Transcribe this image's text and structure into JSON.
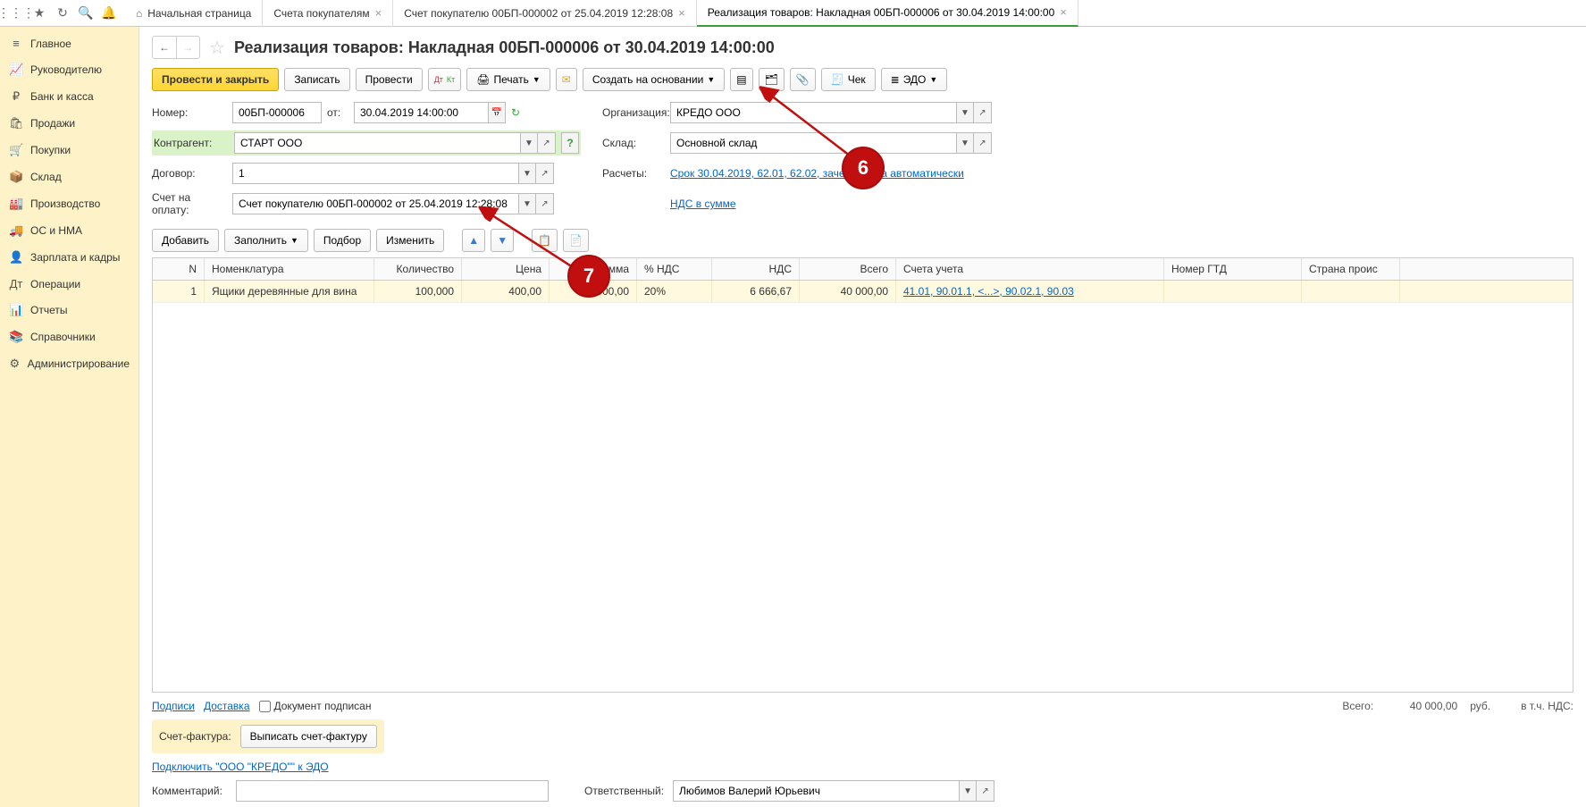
{
  "topbar_icons": [
    "grid",
    "star",
    "history",
    "search",
    "bell"
  ],
  "tabs": [
    {
      "label": "Начальная страница",
      "home": true,
      "closable": false
    },
    {
      "label": "Счета покупателям",
      "closable": true
    },
    {
      "label": "Счет покупателю 00БП-000002 от 25.04.2019 12:28:08",
      "closable": true
    },
    {
      "label": "Реализация товаров: Накладная 00БП-000006 от 30.04.2019 14:00:00",
      "closable": true,
      "active": true
    }
  ],
  "sidebar": [
    {
      "icon": "≡",
      "label": "Главное"
    },
    {
      "icon": "📈",
      "label": "Руководителю"
    },
    {
      "icon": "₽",
      "label": "Банк и касса"
    },
    {
      "icon": "🛍",
      "label": "Продажи"
    },
    {
      "icon": "🛒",
      "label": "Покупки"
    },
    {
      "icon": "📦",
      "label": "Склад"
    },
    {
      "icon": "🏭",
      "label": "Производство"
    },
    {
      "icon": "🚚",
      "label": "ОС и НМА"
    },
    {
      "icon": "👤",
      "label": "Зарплата и кадры"
    },
    {
      "icon": "Дт",
      "label": "Операции"
    },
    {
      "icon": "📊",
      "label": "Отчеты"
    },
    {
      "icon": "📚",
      "label": "Справочники"
    },
    {
      "icon": "⚙",
      "label": "Администрирование"
    }
  ],
  "page_title": "Реализация товаров: Накладная 00БП-000006 от 30.04.2019 14:00:00",
  "toolbar": {
    "post_close": "Провести и закрыть",
    "record": "Записать",
    "post": "Провести",
    "print": "Печать",
    "create_based": "Создать на основании",
    "check": "Чек",
    "edo": "ЭДО"
  },
  "form": {
    "number_lbl": "Номер:",
    "number": "00БП-000006",
    "from_lbl": "от:",
    "date": "30.04.2019 14:00:00",
    "counterparty_lbl": "Контрагент:",
    "counterparty": "СТАРТ ООО",
    "contract_lbl": "Договор:",
    "contract": "1",
    "invoice_lbl": "Счет на оплату:",
    "invoice": "Счет покупателю 00БП-000002 от 25.04.2019 12:28:08",
    "org_lbl": "Организация:",
    "org": "КРЕДО ООО",
    "warehouse_lbl": "Склад:",
    "warehouse": "Основной склад",
    "calc_lbl": "Расчеты:",
    "calc_link": "Срок 30.04.2019, 62.01, 62.02, зачет аванса автоматически",
    "vat_link": "НДС в сумме"
  },
  "tbl_toolbar": {
    "add": "Добавить",
    "fill": "Заполнить",
    "pick": "Подбор",
    "change": "Изменить"
  },
  "grid": {
    "headers": {
      "n": "N",
      "nom": "Номенклатура",
      "qty": "Количество",
      "price": "Цена",
      "sum": "Сумма",
      "vat_pct": "% НДС",
      "nds": "НДС",
      "total": "Всего",
      "acc": "Счета учета",
      "gtd": "Номер ГТД",
      "ctry": "Страна проис"
    },
    "rows": [
      {
        "n": "1",
        "nom": "Ящики деревянные для вина",
        "qty": "100,000",
        "price": "400,00",
        "sum": "40 000,00",
        "vat_pct": "20%",
        "nds": "6 666,67",
        "total": "40 000,00",
        "acc": "41.01, 90.01.1, <...>, 90.02.1, 90.03"
      }
    ]
  },
  "footer": {
    "sign_link": "Подписи",
    "delivery_link": "Доставка",
    "doc_signed": "Документ подписан",
    "totals_lbl": "Всего:",
    "totals_val": "40 000,00",
    "currency": "руб.",
    "incl_vat": "в т.ч. НДС:",
    "sf_lbl": "Счет-фактура:",
    "sf_btn": "Выписать счет-фактуру",
    "edo_link": "Подключить \"ООО \"КРЕДО\"\" к ЭДО",
    "comment_lbl": "Комментарий:",
    "responsible_lbl": "Ответственный:",
    "responsible": "Любимов Валерий Юрьевич"
  },
  "markers": {
    "m6": "6",
    "m7": "7"
  }
}
